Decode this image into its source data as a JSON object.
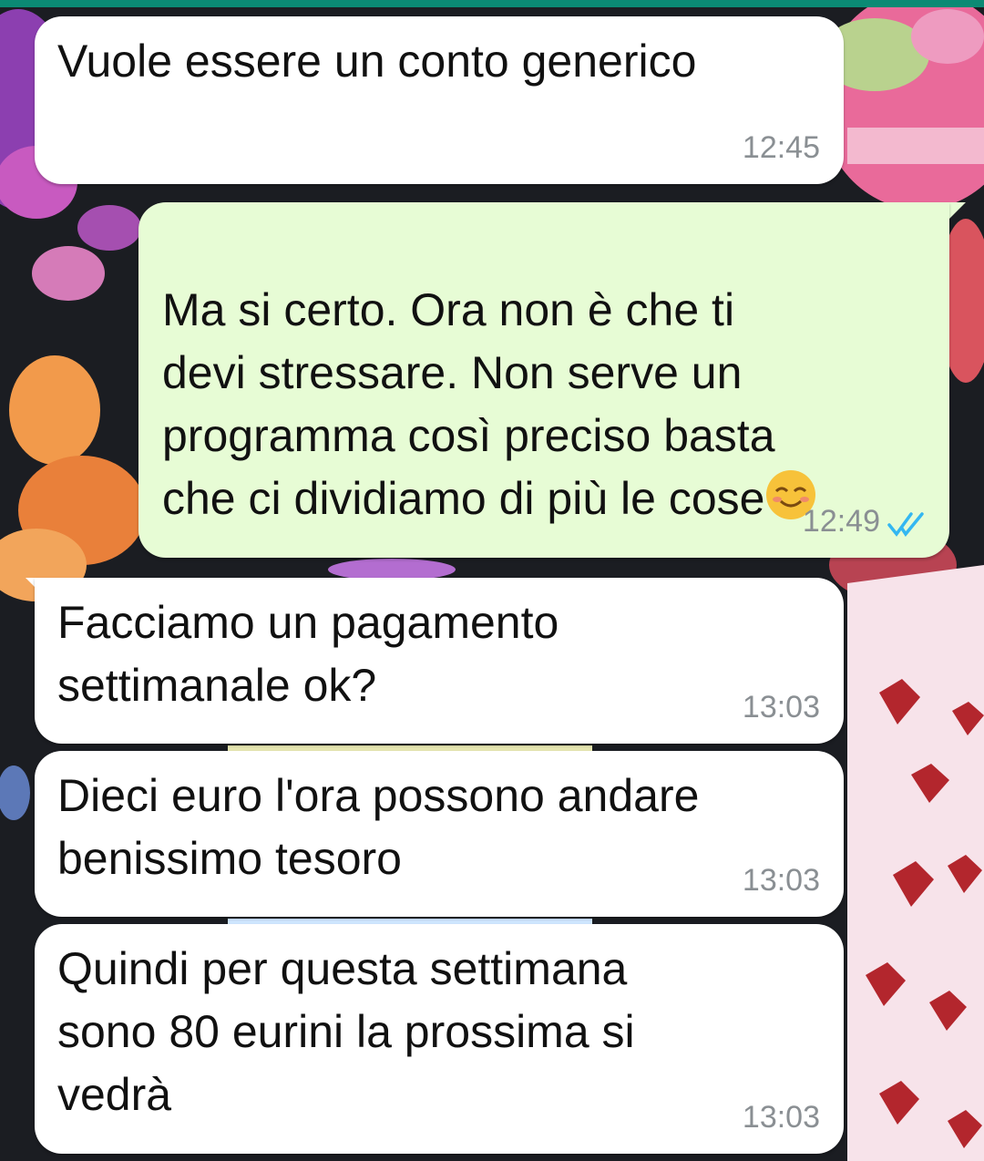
{
  "colors": {
    "incoming_bubble": "#ffffff",
    "outgoing_bubble": "#e7fcd5",
    "timestamp": "#8a8f93",
    "read_ticks": "#34b7f1",
    "header_accent": "#0b8a74"
  },
  "messages": [
    {
      "direction": "incoming",
      "text": "Vuole essere un conto generico",
      "time": "12:45"
    },
    {
      "direction": "outgoing",
      "text": "Ma si certo. Ora non è che ti\ndevi stressare. Non serve un\nprogramma così preciso basta\nche ci dividiamo di più le cose",
      "emoji": "smiling-face-icon",
      "time": "12:49",
      "status": "read"
    },
    {
      "direction": "incoming",
      "text": "Facciamo un pagamento\nsettimanale ok?",
      "time": "13:03"
    },
    {
      "direction": "incoming",
      "text": "Dieci euro l'ora possono andare\nbenissimo tesoro",
      "time": "13:03"
    },
    {
      "direction": "incoming",
      "text": "Quindi per questa settimana\nsono 80 eurini la prossima si\nvedrà",
      "time": "13:03"
    }
  ]
}
